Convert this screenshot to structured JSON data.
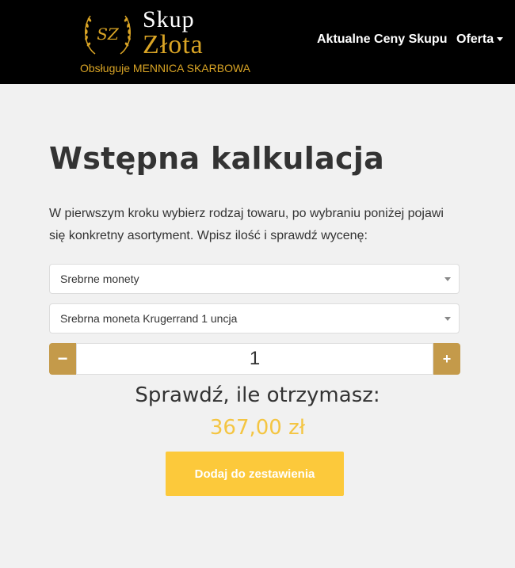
{
  "header": {
    "logo": {
      "monogram": "SZ",
      "title_line1": "Skup",
      "title_line2": "Złota",
      "tagline": "Obsługuje MENNICA SKARBOWA",
      "title_color": "#ffffff",
      "accent_color": "#d9a425"
    },
    "nav": {
      "prices_label": "Aktualne Ceny Skupu",
      "offer_label": "Oferta",
      "offer_icon": "caret-down-icon"
    }
  },
  "main": {
    "title": "Wstępna kalkulacja",
    "intro": "W pierwszym kroku wybierz rodzaj towaru, po wybraniu poniżej pojawi się konkretny asortyment. Wpisz ilość i sprawdź wycenę:",
    "category_select": {
      "selected": "Srebrne monety",
      "icon": "chevron-down-icon"
    },
    "product_select": {
      "selected": "Srebrna moneta Krugerrand 1 uncja",
      "icon": "chevron-down-icon"
    },
    "quantity": {
      "value": "1",
      "minus_label": "−",
      "plus_label": "+",
      "button_color": "#c49a4a"
    },
    "check_label": "Sprawdź, ile otrzymasz:",
    "price": "367,00 zł",
    "price_color": "#f4c542",
    "add_button_label": "Dodaj do zestawienia",
    "add_button_color": "#fcc93b"
  }
}
